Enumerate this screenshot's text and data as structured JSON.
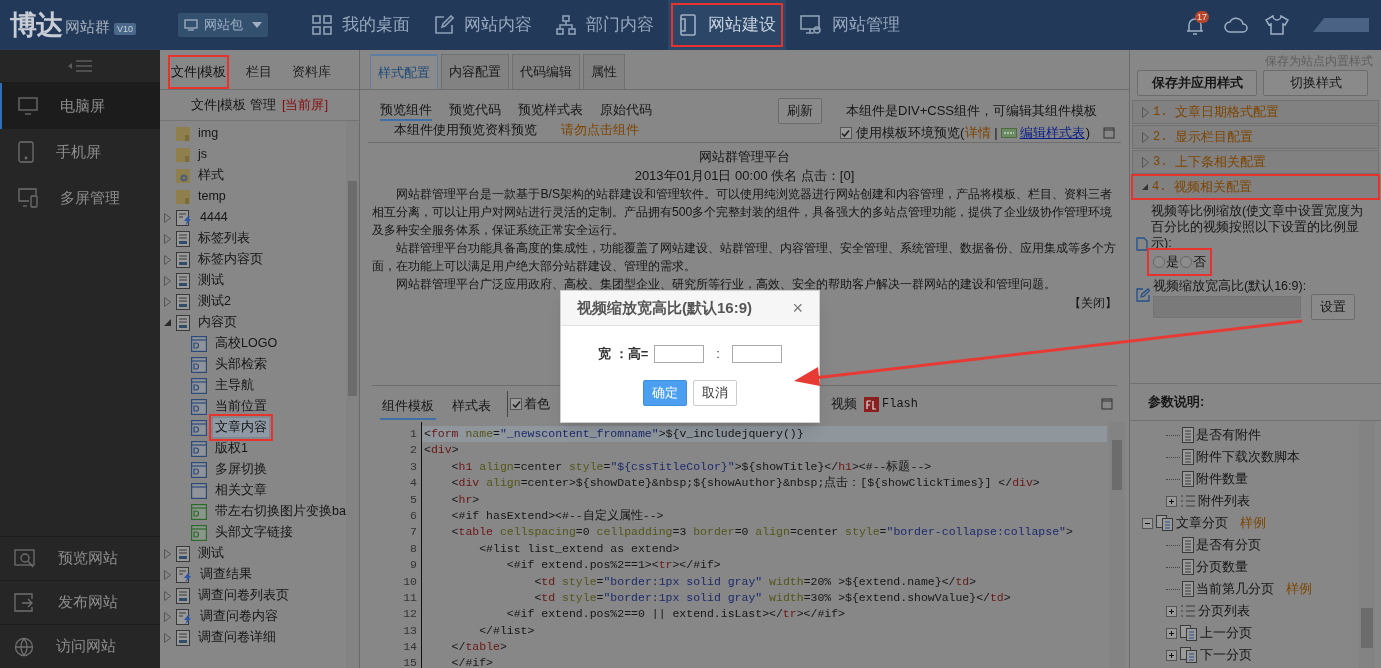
{
  "topbar": {
    "logo": "博达",
    "product": "网站群",
    "version": "V10",
    "site_select": "网站包",
    "notification_count": "17",
    "nav": [
      {
        "label": "我的桌面",
        "selected": false,
        "highlighted": false
      },
      {
        "label": "网站内容",
        "selected": false,
        "highlighted": false
      },
      {
        "label": "部门内容",
        "selected": false,
        "highlighted": false
      },
      {
        "label": "网站建设",
        "selected": true,
        "highlighted": true
      },
      {
        "label": "网站管理",
        "selected": false,
        "highlighted": false
      }
    ]
  },
  "sidebar": {
    "items": [
      {
        "label": "电脑屏",
        "selected": true
      },
      {
        "label": "手机屏",
        "selected": false
      },
      {
        "label": "多屏管理",
        "selected": false
      }
    ],
    "bottom_items": [
      {
        "label": "预览网站"
      },
      {
        "label": "发布网站"
      },
      {
        "label": "访问网站"
      }
    ]
  },
  "file_panel": {
    "tabs": [
      {
        "label": "文件|模板",
        "selected": true,
        "highlighted": true
      },
      {
        "label": "栏目",
        "selected": false,
        "highlighted": false
      },
      {
        "label": "资料库",
        "selected": false,
        "highlighted": false
      }
    ],
    "heading": "文件|模板 管理",
    "heading_tag": "[当前屏]",
    "tree": [
      {
        "label": "img",
        "kind": "folder"
      },
      {
        "label": "js",
        "kind": "folder"
      },
      {
        "label": "样式",
        "kind": "style-folder"
      },
      {
        "label": "temp",
        "kind": "folder"
      },
      {
        "label": "4444",
        "kind": "dynamic-page",
        "expanded": false
      },
      {
        "label": "标签列表",
        "kind": "page",
        "expanded": false
      },
      {
        "label": "标签内容页",
        "kind": "page",
        "expanded": false
      },
      {
        "label": "测试",
        "kind": "page",
        "expanded": false
      },
      {
        "label": "测试2",
        "kind": "page",
        "expanded": false
      },
      {
        "label": "内容页",
        "kind": "page",
        "expanded": true,
        "children": [
          {
            "label": "高校LOGO",
            "kind": "component",
            "selected": false,
            "highlighted": false
          },
          {
            "label": "头部检索",
            "kind": "component",
            "selected": false,
            "highlighted": false
          },
          {
            "label": "主导航",
            "kind": "component",
            "selected": false,
            "highlighted": false
          },
          {
            "label": "当前位置",
            "kind": "component",
            "selected": false,
            "highlighted": false
          },
          {
            "label": "文章内容",
            "kind": "component",
            "selected": true,
            "highlighted": true
          },
          {
            "label": "版权1",
            "kind": "component",
            "selected": false,
            "highlighted": false
          },
          {
            "label": "多屏切换",
            "kind": "component",
            "selected": false,
            "highlighted": false
          },
          {
            "label": "相关文章",
            "kind": "plain-component",
            "selected": false,
            "highlighted": false
          },
          {
            "label": "带左右切换图片变换ba",
            "kind": "green-component",
            "selected": false,
            "highlighted": false
          },
          {
            "label": "头部文字链接",
            "kind": "green-component",
            "selected": false,
            "highlighted": false
          }
        ]
      },
      {
        "label": "测试",
        "kind": "page",
        "expanded": false
      },
      {
        "label": "调查结果",
        "kind": "dynamic-page",
        "expanded": false
      },
      {
        "label": "调查问卷列表页",
        "kind": "page",
        "expanded": false
      },
      {
        "label": "调查问卷内容",
        "kind": "dynamic-page",
        "expanded": false
      },
      {
        "label": "调查问卷详细",
        "kind": "page",
        "expanded": false
      }
    ]
  },
  "editor": {
    "tabs": [
      {
        "label": "样式配置",
        "selected": true
      },
      {
        "label": "内容配置",
        "selected": false
      },
      {
        "label": "代码编辑",
        "selected": false
      },
      {
        "label": "属性",
        "selected": false
      }
    ],
    "preview_tabs": [
      {
        "label": "预览组件",
        "selected": true
      },
      {
        "label": "预览代码",
        "selected": false
      },
      {
        "label": "预览样式表",
        "selected": false
      },
      {
        "label": "原始代码",
        "selected": false
      }
    ],
    "preview_note": "本组件使用预览资料预览",
    "warning": "请勿点击组件",
    "refresh_button": "刷新",
    "component_info": "本组件是DIV+CSS组件，可编辑其组件模板",
    "env_preview": {
      "label": "使用模板环境预览(",
      "checked": true
    },
    "details_link": "详情",
    "link_separator": "|",
    "edit_stylesheet_link": "编辑样式表",
    "link_close": ")",
    "article": {
      "title": "网站群管理平台",
      "meta": "2013年01月01日 00:00 佚名 点击：[0]",
      "paragraphs": [
        "网站群管理平台是一款基于B/S架构的站群建设和管理软件。可以使用纯浏览器进行网站创建和内容管理，产品将模板、栏目、资料三者相互分离，可以让用户对网站进行灵活的定制。产品拥有500多个完整封装的组件，具备强大的多站点管理功能，提供了企业级协作管理环境及多种安全服务体系，保证系统正常安全运行。",
        "站群管理平台功能具备高度的集成性，功能覆盖了网站建设、站群管理、内容管理、安全管理、系统管理、数据备份、应用集成等多个方面，在功能上可以满足用户绝大部分站群建设、管理的需求。",
        "网站群管理平台广泛应用政府、高校、集团型企业、研究所等行业，高效、安全的帮助客户解决一群网站的建设和管理问题。"
      ]
    },
    "close_link": "【关闭】",
    "code_tabs": [
      {
        "label": "组件模板",
        "selected": true
      },
      {
        "label": "样式表",
        "selected": false
      }
    ],
    "toolbar": [
      {
        "label": "着色",
        "kind": "checkbox",
        "checked": true
      },
      {
        "label": "视频",
        "kind": "button"
      },
      {
        "label": "Flash",
        "kind": "flash"
      }
    ],
    "code_lines": [
      {
        "number": "1",
        "text": "<form name=\"_newscontent_fromname\">${v_includejquery()}",
        "current": true
      },
      {
        "number": "2",
        "text": "<div>",
        "current": false
      },
      {
        "number": "3",
        "text": "    <h1 align=center style=\"${cssTitleColor}\">${showTitle}</h1><#--标题-->",
        "current": false
      },
      {
        "number": "4",
        "text": "    <div align=center>${showDate}&nbsp;${showAuthor}&nbsp;点击：[${showClickTimes}] </div>",
        "current": false
      },
      {
        "number": "5",
        "text": "    <hr>",
        "current": false
      },
      {
        "number": "6",
        "text": "    <#if hasExtend><#--自定义属性-->",
        "current": false
      },
      {
        "number": "7",
        "text": "    <table cellspacing=0 cellpadding=3 border=0 align=center style=\"border-collapse:collapse\">",
        "current": false
      },
      {
        "number": "8",
        "text": "        <#list list_extend as extend>",
        "current": false
      },
      {
        "number": "9",
        "text": "            <#if extend.pos%2==1><tr></#if>",
        "current": false
      },
      {
        "number": "10",
        "text": "                <td style=\"border:1px solid gray\" width=20% >${extend.name}</td>",
        "current": false
      },
      {
        "number": "11",
        "text": "                <td style=\"border:1px solid gray\" width=30% >${extend.showValue}</td>",
        "current": false
      },
      {
        "number": "12",
        "text": "            <#if extend.pos%2==0 || extend.isLast></tr></#if>",
        "current": false
      },
      {
        "number": "13",
        "text": "        </#list>",
        "current": false
      },
      {
        "number": "14",
        "text": "    </table>",
        "current": false
      },
      {
        "number": "15",
        "text": "    </#if>",
        "current": false
      }
    ]
  },
  "right_panel": {
    "save_builtin_link": "保存为站点内置样式",
    "save_button": "保存并应用样式",
    "switch_button": "切换样式",
    "sections": [
      {
        "number": "1.",
        "title": "文章日期格式配置",
        "expanded": false,
        "highlighted": false
      },
      {
        "number": "2.",
        "title": "显示栏目配置",
        "expanded": false,
        "highlighted": false
      },
      {
        "number": "3.",
        "title": "上下条相关配置",
        "expanded": false,
        "highlighted": false
      },
      {
        "number": "4.",
        "title": "视频相关配置",
        "expanded": true,
        "highlighted": true
      }
    ],
    "video_scale": {
      "label": "视频等比例缩放(使文章中设置宽度为百分比的视频按照以下设置的比例显示):",
      "highlighted": true,
      "options": [
        {
          "label": "是",
          "selected": false
        },
        {
          "label": "否",
          "selected": false
        }
      ]
    },
    "aspect_ratio": {
      "label": "视频缩放宽高比(默认16:9):",
      "button": "设置"
    },
    "params_title": "参数说明:",
    "param_tree": [
      {
        "label": "是否有附件",
        "kind": "field"
      },
      {
        "label": "附件下载次数脚本",
        "kind": "field"
      },
      {
        "label": "附件数量",
        "kind": "field"
      },
      {
        "label": "附件列表",
        "kind": "list",
        "expanded": false
      },
      {
        "label": "文章分页",
        "kind": "pages",
        "expanded": true,
        "tag": "样例",
        "children": [
          {
            "label": "是否有分页",
            "kind": "field"
          },
          {
            "label": "分页数量",
            "kind": "field"
          },
          {
            "label": "当前第几分页",
            "kind": "field",
            "tag": "样例"
          },
          {
            "label": "分页列表",
            "kind": "list",
            "expanded": false
          },
          {
            "label": "上一分页",
            "kind": "pages",
            "expanded": false
          },
          {
            "label": "下一分页",
            "kind": "pages",
            "expanded": false
          }
        ]
      }
    ]
  },
  "dialog": {
    "title": "视频缩放宽高比(默认16:9)",
    "close": "×",
    "ratio_label": "宽 ：高=",
    "separator": ":",
    "ok_button": "确定",
    "cancel_button": "取消"
  }
}
